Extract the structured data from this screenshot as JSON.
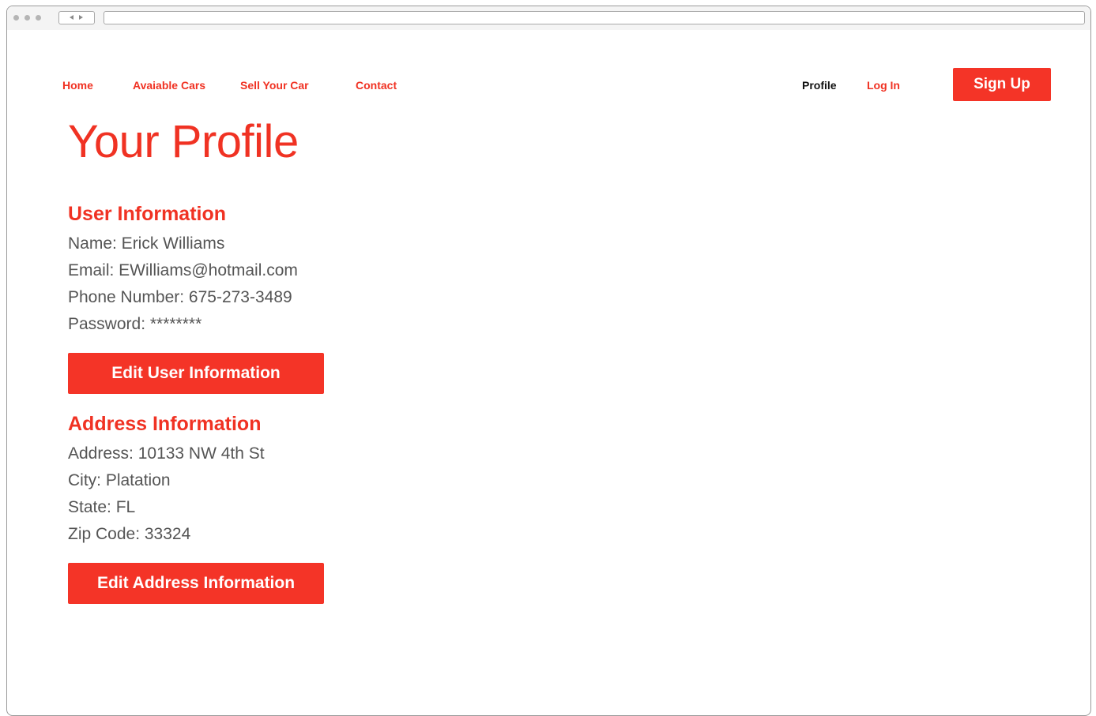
{
  "nav": {
    "home": "Home",
    "available_cars": "Avaiable Cars",
    "sell_your_car": "Sell Your Car",
    "contact": "Contact",
    "profile": "Profile",
    "log_in": "Log In",
    "sign_up": "Sign Up"
  },
  "page": {
    "title": "Your Profile"
  },
  "user_info": {
    "heading": "User Information",
    "name": "Name: Erick Williams",
    "email": "Email: EWilliams@hotmail.com",
    "phone": "Phone Number: 675-273-3489",
    "password": "Password: ********",
    "edit_button": "Edit User Information"
  },
  "address_info": {
    "heading": "Address Information",
    "address": "Address: 10133 NW 4th St",
    "city": "City: Platation",
    "state": "State: FL",
    "zip": "Zip Code: 33324",
    "edit_button": "Edit Address Information"
  },
  "colors": {
    "accent": "#f43427",
    "active_nav": "#111111",
    "body_text": "#555555"
  }
}
